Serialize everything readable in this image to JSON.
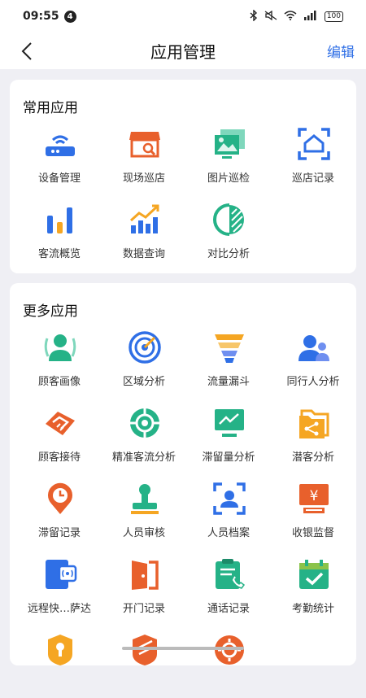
{
  "status": {
    "time": "09:55",
    "notif_count": "4",
    "battery": "100"
  },
  "nav": {
    "title": "应用管理",
    "edit": "编辑"
  },
  "sections": [
    {
      "title": "常用应用",
      "items": [
        {
          "label": "设备管理",
          "icon": "router-icon",
          "color": "#2f6fe6"
        },
        {
          "label": "现场巡店",
          "icon": "store-search-icon",
          "color": "#e8602c"
        },
        {
          "label": "图片巡检",
          "icon": "image-gallery-icon",
          "color": "#25b287"
        },
        {
          "label": "巡店记录",
          "icon": "scan-home-icon",
          "color": "#2f6fe6"
        },
        {
          "label": "客流概览",
          "icon": "bar-chart-icon",
          "color": "#2f6fe6"
        },
        {
          "label": "数据查询",
          "icon": "bar-trend-icon",
          "color": "#f5a623"
        },
        {
          "label": "对比分析",
          "icon": "compare-circle-icon",
          "color": "#25b287"
        }
      ]
    },
    {
      "title": "更多应用",
      "items": [
        {
          "label": "顾客画像",
          "icon": "user-profile-icon",
          "color": "#25b287"
        },
        {
          "label": "区域分析",
          "icon": "radar-icon",
          "color": "#2f6fe6"
        },
        {
          "label": "流量漏斗",
          "icon": "funnel-icon",
          "color": "#f5a623"
        },
        {
          "label": "同行人分析",
          "icon": "group-users-icon",
          "color": "#2f6fe6"
        },
        {
          "label": "顾客接待",
          "icon": "handshake-icon",
          "color": "#e8602c"
        },
        {
          "label": "精准客流分析",
          "icon": "target-icon",
          "color": "#25b287"
        },
        {
          "label": "滞留量分析",
          "icon": "monitor-trend-icon",
          "color": "#25b287"
        },
        {
          "label": "潜客分析",
          "icon": "share-folder-icon",
          "color": "#f5a623"
        },
        {
          "label": "滞留记录",
          "icon": "clock-pin-icon",
          "color": "#e8602c"
        },
        {
          "label": "人员审核",
          "icon": "stamp-icon",
          "color": "#25b287"
        },
        {
          "label": "人员档案",
          "icon": "face-scan-icon",
          "color": "#2f6fe6"
        },
        {
          "label": "收银监督",
          "icon": "cashier-icon",
          "color": "#e8602c"
        },
        {
          "label": "远程快…萨达",
          "icon": "remote-door-icon",
          "color": "#2f6fe6"
        },
        {
          "label": "开门记录",
          "icon": "door-open-icon",
          "color": "#e8602c"
        },
        {
          "label": "通话记录",
          "icon": "phone-clipboard-icon",
          "color": "#25b287"
        },
        {
          "label": "考勤统计",
          "icon": "calendar-check-icon",
          "color": "#25b287"
        },
        {
          "label": "",
          "icon": "keyhole-badge-icon",
          "color": "#f5a623"
        },
        {
          "label": "",
          "icon": "shield-icon",
          "color": "#e8602c"
        },
        {
          "label": "",
          "icon": "gear-badge-icon",
          "color": "#e8602c"
        }
      ]
    }
  ]
}
